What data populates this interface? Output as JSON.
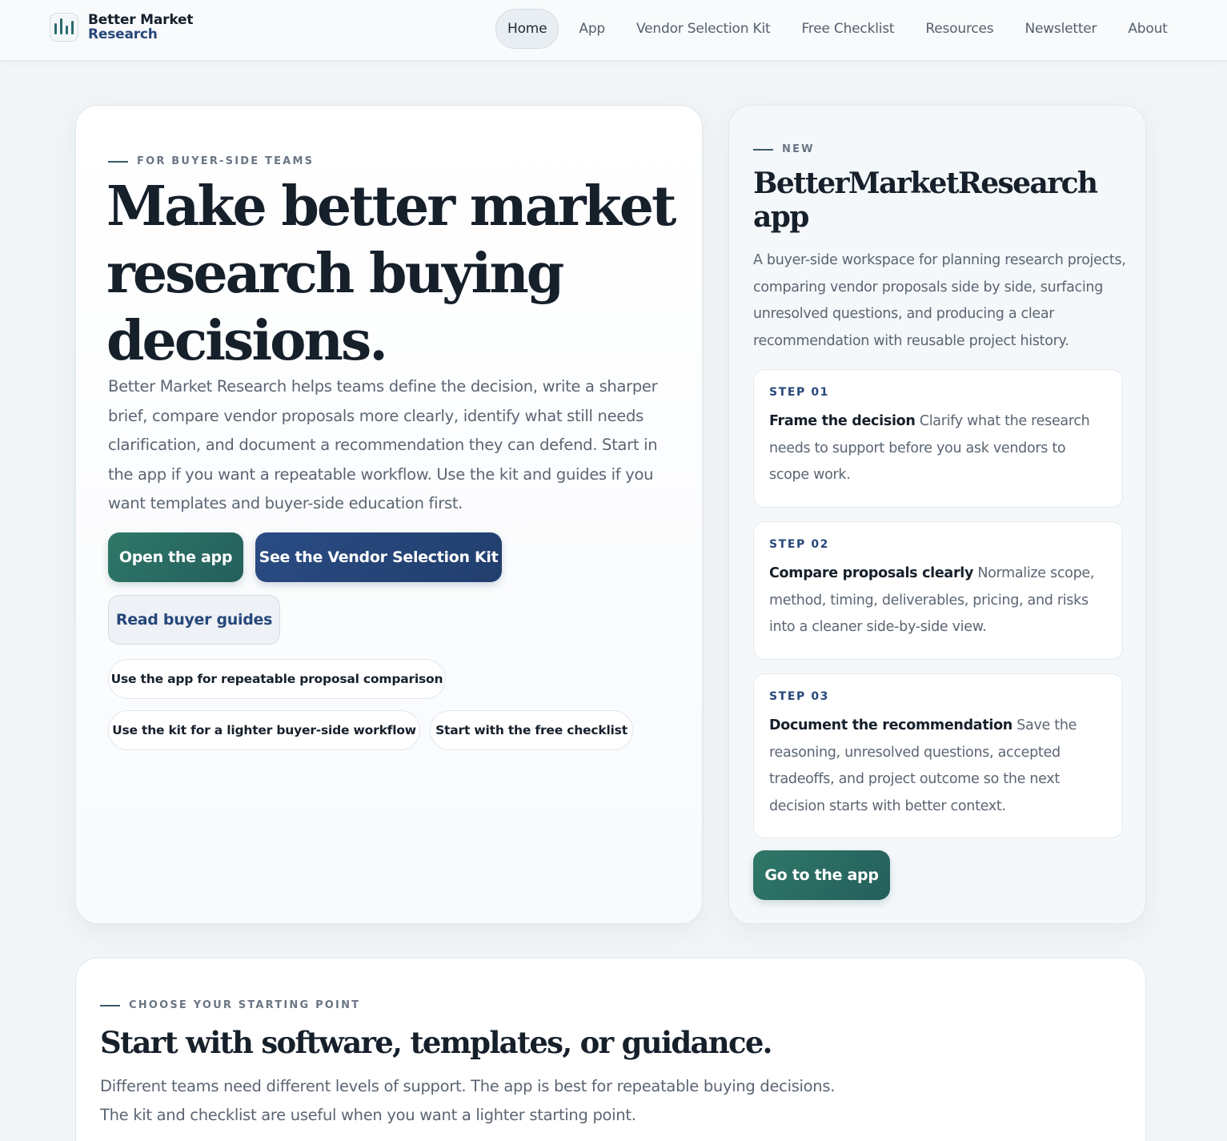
{
  "brand": {
    "line1": "Better Market",
    "line2": "Research",
    "icon": "bar-chart-logo-icon"
  },
  "nav": {
    "items": [
      {
        "label": "Home",
        "active": true
      },
      {
        "label": "App"
      },
      {
        "label": "Vendor Selection Kit"
      },
      {
        "label": "Free Checklist"
      },
      {
        "label": "Resources"
      },
      {
        "label": "Newsletter"
      },
      {
        "label": "About"
      }
    ]
  },
  "hero": {
    "eyebrow": "FOR BUYER-SIDE TEAMS",
    "title": "Make better market research buying decisions.",
    "description": "Better Market Research helps teams define the decision, write a sharper brief, compare vendor proposals more clearly, identify what still needs clarification, and document a recommendation they can defend. Start in the app if you want a repeatable workflow. Use the kit and guides if you want templates and buyer-side education first.",
    "buttons": {
      "open_app": "Open the app",
      "vendor_kit": "See the Vendor Selection Kit",
      "buyer_guides": "Read buyer guides"
    },
    "chips": [
      "Use the app for repeatable proposal comparison",
      "Use the kit for a lighter buyer-side workflow",
      "Start with the free checklist"
    ]
  },
  "app_card": {
    "eyebrow": "NEW",
    "title": "BetterMarketResearch app",
    "description": "A buyer-side workspace for planning research projects, comparing vendor proposals side by side, surfacing unresolved questions, and producing a clear recommendation with reusable project history.",
    "steps": [
      {
        "label": "STEP 01",
        "heading": "Frame the decision",
        "text": "Clarify what the research needs to support before you ask vendors to scope work."
      },
      {
        "label": "STEP 02",
        "heading": "Compare proposals clearly",
        "text": "Normalize scope, method, timing, deliverables, pricing, and risks into a cleaner side-by-side view."
      },
      {
        "label": "STEP 03",
        "heading": "Document the recommendation",
        "text": "Save the reasoning, unresolved questions, accepted tradeoffs, and project outcome so the next decision starts with better context."
      }
    ],
    "cta": "Go to the app"
  },
  "section": {
    "eyebrow": "CHOOSE YOUR STARTING POINT",
    "title": "Start with software, templates, or guidance.",
    "description": "Different teams need different levels of support. The app is best for repeatable buying decisions. The kit and checklist are useful when you want a lighter starting point."
  },
  "colors": {
    "accent_green": "#245e5c",
    "accent_navy": "#213e6d",
    "background": "#f1f5f7",
    "text_dark": "#16202b",
    "text_muted": "#5b6573"
  }
}
